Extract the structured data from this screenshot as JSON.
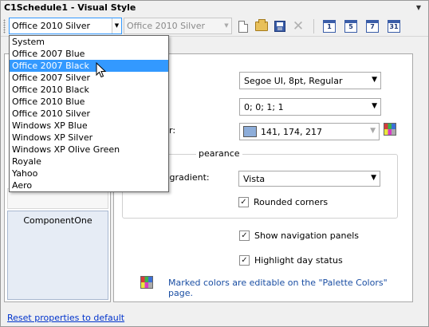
{
  "window": {
    "title": "C1Schedule1 - Visual Style"
  },
  "toolbar": {
    "style_combo_value": "Office 2010 Silver",
    "style_combo_disabled_value": "Office 2010 Silver",
    "calendar_buttons": [
      "1",
      "5",
      "7",
      "31"
    ]
  },
  "dropdown": {
    "items": [
      "System",
      "Office 2007 Blue",
      "Office 2007 Black",
      "Office 2007 Silver",
      "Office 2010 Black",
      "Office 2010 Blue",
      "Office 2010 Silver",
      "Windows XP Blue",
      "Windows XP Silver",
      "Windows XP Olive Green",
      "Royale",
      "Yahoo",
      "Aero"
    ],
    "selected_index": 2
  },
  "left_pane": {
    "component_label": "ComponentOne"
  },
  "props": {
    "font_value": "Segoe UI, 8pt, Regular",
    "margin_value": "0; 0; 1; 1",
    "color_label_fragment": "r:",
    "color_value": "141, 174, 217",
    "color_swatch": "#8dadd9",
    "appearance_group_fragment": "pearance",
    "gradient_label_fragment": "l gradient:",
    "gradient_value": "Vista",
    "rounded_corners_label": "Rounded corners",
    "rounded_corners_checked": true,
    "show_nav_label": "Show navigation panels",
    "show_nav_checked": true,
    "highlight_day_label": "Highlight day status",
    "highlight_day_checked": true,
    "note": "Marked colors are editable on the \"Palette Colors\" page."
  },
  "footer": {
    "reset_link": "Reset properties to default"
  },
  "colors": {
    "accent": "#3399ff",
    "link": "#0033cc",
    "note": "#1a4ea3"
  }
}
